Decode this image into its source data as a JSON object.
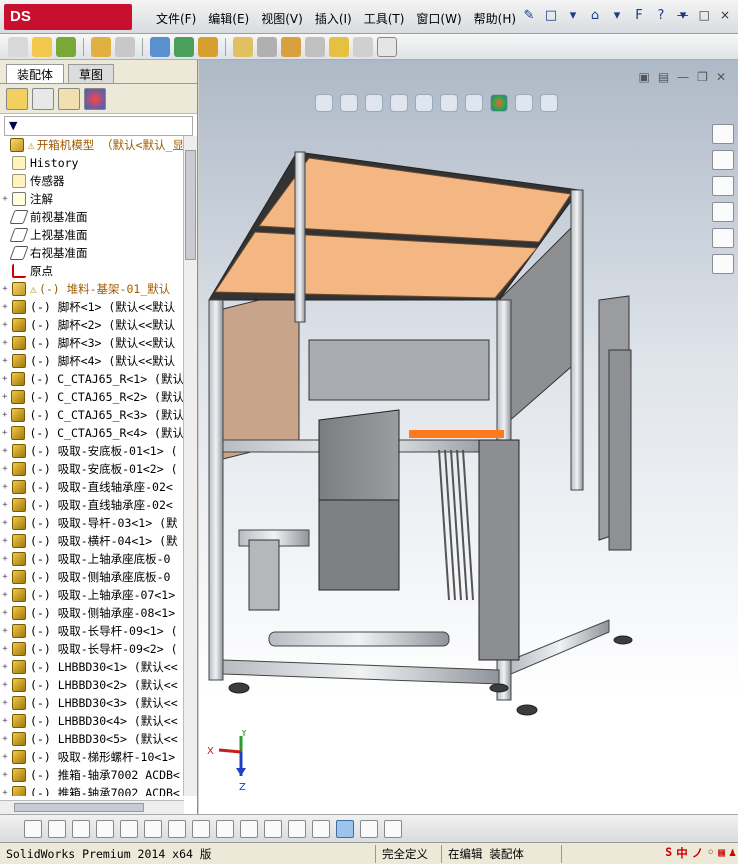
{
  "app": {
    "logo": "DS SOLIDWORKS"
  },
  "menu": [
    "文件(F)",
    "编辑(E)",
    "视图(V)",
    "插入(I)",
    "工具(T)",
    "窗口(W)",
    "帮助(H)"
  ],
  "quick": [
    "✎",
    "□",
    "▾",
    "⌂",
    "▾",
    "F",
    "?",
    "▾"
  ],
  "window_controls": [
    "—",
    "□",
    "×"
  ],
  "tabs": {
    "assembly": "装配体",
    "sketch": "草图"
  },
  "filter": "▼",
  "tree": [
    {
      "exp": "",
      "icon": "asm",
      "warn": "⚠",
      "text": "开箱机模型 （默认<默认_显",
      "orange": true
    },
    {
      "exp": "",
      "icon": "doc",
      "text": "History"
    },
    {
      "exp": "",
      "icon": "doc",
      "text": "传感器"
    },
    {
      "exp": "+",
      "icon": "ann",
      "text": "注解"
    },
    {
      "exp": "",
      "icon": "plane",
      "text": "前视基准面"
    },
    {
      "exp": "",
      "icon": "plane",
      "text": "上视基准面"
    },
    {
      "exp": "",
      "icon": "plane",
      "text": "右视基准面"
    },
    {
      "exp": "",
      "icon": "origin",
      "text": "原点"
    },
    {
      "exp": "+",
      "icon": "asm",
      "warn": "⚠",
      "text": "(-) 堆料-基架-01_默认",
      "orange": true
    },
    {
      "exp": "+",
      "icon": "part",
      "text": "(-) 脚杯<1> (默认<<默认"
    },
    {
      "exp": "+",
      "icon": "part",
      "text": "(-) 脚杯<2> (默认<<默认"
    },
    {
      "exp": "+",
      "icon": "part",
      "text": "(-) 脚杯<3> (默认<<默认"
    },
    {
      "exp": "+",
      "icon": "part",
      "text": "(-) 脚杯<4> (默认<<默认"
    },
    {
      "exp": "+",
      "icon": "part",
      "text": "(-) C_CTAJ65_R<1> (默认"
    },
    {
      "exp": "+",
      "icon": "part",
      "text": "(-) C_CTAJ65_R<2> (默认"
    },
    {
      "exp": "+",
      "icon": "part",
      "text": "(-) C_CTAJ65_R<3> (默认"
    },
    {
      "exp": "+",
      "icon": "part",
      "text": "(-) C_CTAJ65_R<4> (默认"
    },
    {
      "exp": "+",
      "icon": "part",
      "text": "(-) 吸取-安底板-01<1> ("
    },
    {
      "exp": "+",
      "icon": "part",
      "text": "(-) 吸取-安底板-01<2> ("
    },
    {
      "exp": "+",
      "icon": "part",
      "text": "(-) 吸取-直线轴承座-02<"
    },
    {
      "exp": "+",
      "icon": "part",
      "text": "(-) 吸取-直线轴承座-02<"
    },
    {
      "exp": "+",
      "icon": "part",
      "text": "(-) 吸取-导杆-03<1> (默"
    },
    {
      "exp": "+",
      "icon": "part",
      "text": "(-) 吸取-横杆-04<1> (默"
    },
    {
      "exp": "+",
      "icon": "part",
      "text": "(-) 吸取-上轴承座底板-0"
    },
    {
      "exp": "+",
      "icon": "part",
      "text": "(-) 吸取-侧轴承座底板-0"
    },
    {
      "exp": "+",
      "icon": "part",
      "text": "(-) 吸取-上轴承座-07<1>"
    },
    {
      "exp": "+",
      "icon": "part",
      "text": "(-) 吸取-侧轴承座-08<1>"
    },
    {
      "exp": "+",
      "icon": "part",
      "text": "(-) 吸取-长导杆-09<1> ("
    },
    {
      "exp": "+",
      "icon": "part",
      "text": "(-) 吸取-长导杆-09<2> ("
    },
    {
      "exp": "+",
      "icon": "part",
      "text": "(-) LHBBD30<1> (默认<<"
    },
    {
      "exp": "+",
      "icon": "part",
      "text": "(-) LHBBD30<2> (默认<<"
    },
    {
      "exp": "+",
      "icon": "part",
      "text": "(-) LHBBD30<3> (默认<<"
    },
    {
      "exp": "+",
      "icon": "part",
      "text": "(-) LHBBD30<4> (默认<<"
    },
    {
      "exp": "+",
      "icon": "part",
      "text": "(-) LHBBD30<5> (默认<<"
    },
    {
      "exp": "+",
      "icon": "part",
      "text": "(-) 吸取-梯形螺杆-10<1>"
    },
    {
      "exp": "+",
      "icon": "part",
      "text": "(-) 推箱-轴承7002 ACDB<"
    },
    {
      "exp": "+",
      "icon": "part",
      "text": "(-) 推箱-轴承7002 ACDB<"
    }
  ],
  "triad": {
    "x": "X",
    "y": "Y",
    "z": "Z"
  },
  "status": {
    "product": "SolidWorks Premium 2014 x64 版",
    "defined": "完全定义",
    "editing": "在编辑 装配体"
  },
  "ime": [
    "S",
    "中",
    "ノ",
    "◦",
    "▦",
    "♟"
  ]
}
